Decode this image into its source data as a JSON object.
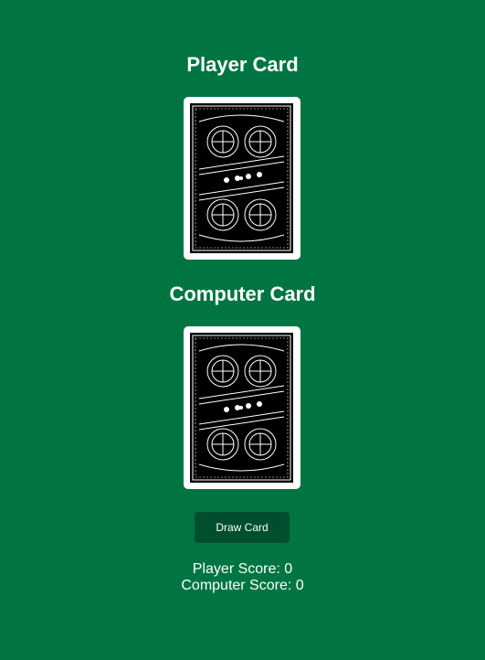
{
  "player": {
    "title": "Player Card",
    "score_label": "Player Score: 0"
  },
  "computer": {
    "title": "Computer Card",
    "score_label": "Computer Score: 0"
  },
  "controls": {
    "draw_label": "Draw Card"
  },
  "colors": {
    "table_background": "#007542",
    "button_background": "#004e2e",
    "card_face": "#ffffff",
    "card_back_ink": "#000000"
  },
  "icons": {
    "card_back": "playing-card-back-icon"
  }
}
